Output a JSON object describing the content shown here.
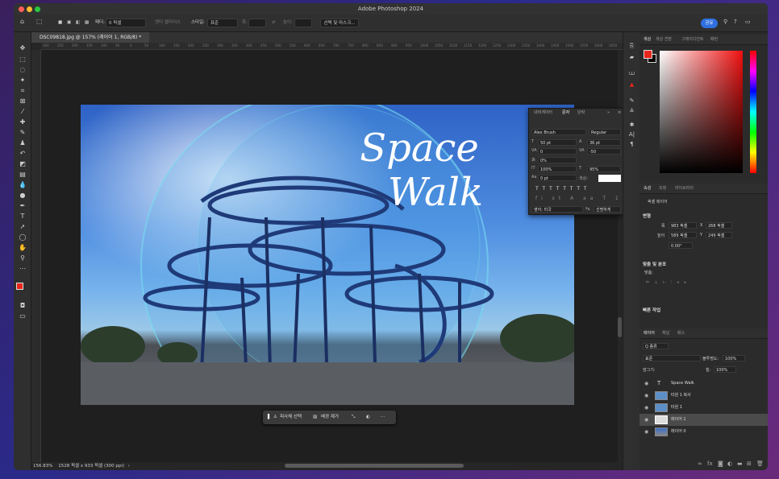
{
  "app": {
    "title": "Adobe Photoshop 2024"
  },
  "options": {
    "feather_label": "페더:",
    "feather_value": "0 픽셀",
    "antialias": "앤티 앨리어스",
    "style_label": "스타일:",
    "style_value": "표준",
    "width_label": "폭:",
    "height_label": "높이:",
    "select_mask": "선택 및 마스크...",
    "share": "공유"
  },
  "document": {
    "tab": "DSC09818.jpg @ 157% (레이어 1, RGB/8) *"
  },
  "ruler": {
    "ticks": [
      "300",
      "250",
      "200",
      "150",
      "100",
      "50",
      "0",
      "50",
      "100",
      "150",
      "200",
      "250",
      "300",
      "350",
      "400",
      "450",
      "500",
      "550",
      "600",
      "650",
      "700",
      "750",
      "800",
      "850",
      "900",
      "950",
      "1000",
      "1050",
      "1100",
      "1150",
      "1200",
      "1250",
      "1300",
      "1350",
      "1400",
      "1450",
      "1500",
      "1550",
      "1600",
      "1650"
    ]
  },
  "canvas": {
    "line1": "Space",
    "line2": "Walk"
  },
  "context": {
    "subject": "피사체 선택",
    "remove_bg": "배경 제거"
  },
  "status": {
    "zoom": "156.83%",
    "size": "1528 픽셀 x 933 픽셀 (300 ppi)"
  },
  "character": {
    "tabs": [
      "내비게이터",
      "문자",
      "단락"
    ],
    "font": "Alex Brush",
    "style": "Regular",
    "size": "50 pt",
    "leading": "36 pt",
    "kerning": "0",
    "tracking": "-50",
    "tsume": "0%",
    "vscale": "100%",
    "hscale": "95%",
    "baseline": "0 pt",
    "color_label": "색상:",
    "lang": "영어: 미국",
    "aa_label": "ªa",
    "aa": "선명하게"
  },
  "right": {
    "color_tabs": [
      "색상",
      "색상 견본",
      "그레이디언트",
      "패턴"
    ],
    "props_tabs": [
      "속성",
      "조정",
      "라이브러리"
    ],
    "pixel_layer": "픽셀 레이어",
    "transform": "변형",
    "w_label": "폭",
    "w_value": "983 픽셀",
    "x_label": "X",
    "x_value": "268 픽셀",
    "h_label": "높이",
    "h_value": "589 픽셀",
    "y_label": "Y",
    "y_value": "249 픽셀",
    "angle": "0.00°",
    "align": "맞춤 및 분포",
    "align_sub": "맞춤:",
    "quick": "빠른 작업",
    "layer_tabs": [
      "레이어",
      "채널",
      "패스"
    ],
    "kind": "Q 종류",
    "blend": "표준",
    "opacity_label": "불투명도:",
    "opacity": "100%",
    "lock_label": "잠그기:",
    "fill_label": "칠:",
    "fill": "100%",
    "layers": [
      {
        "name": "Space      Walk",
        "type": "text"
      },
      {
        "name": "타원 1 복사",
        "type": "shape"
      },
      {
        "name": "타원 1",
        "type": "shape"
      },
      {
        "name": "레이어 1",
        "type": "pixel"
      },
      {
        "name": "레이어 0",
        "type": "photo"
      }
    ]
  },
  "colors": {
    "foreground": "#e8261c",
    "background": "#000000",
    "accent": "#2f6fdf"
  }
}
